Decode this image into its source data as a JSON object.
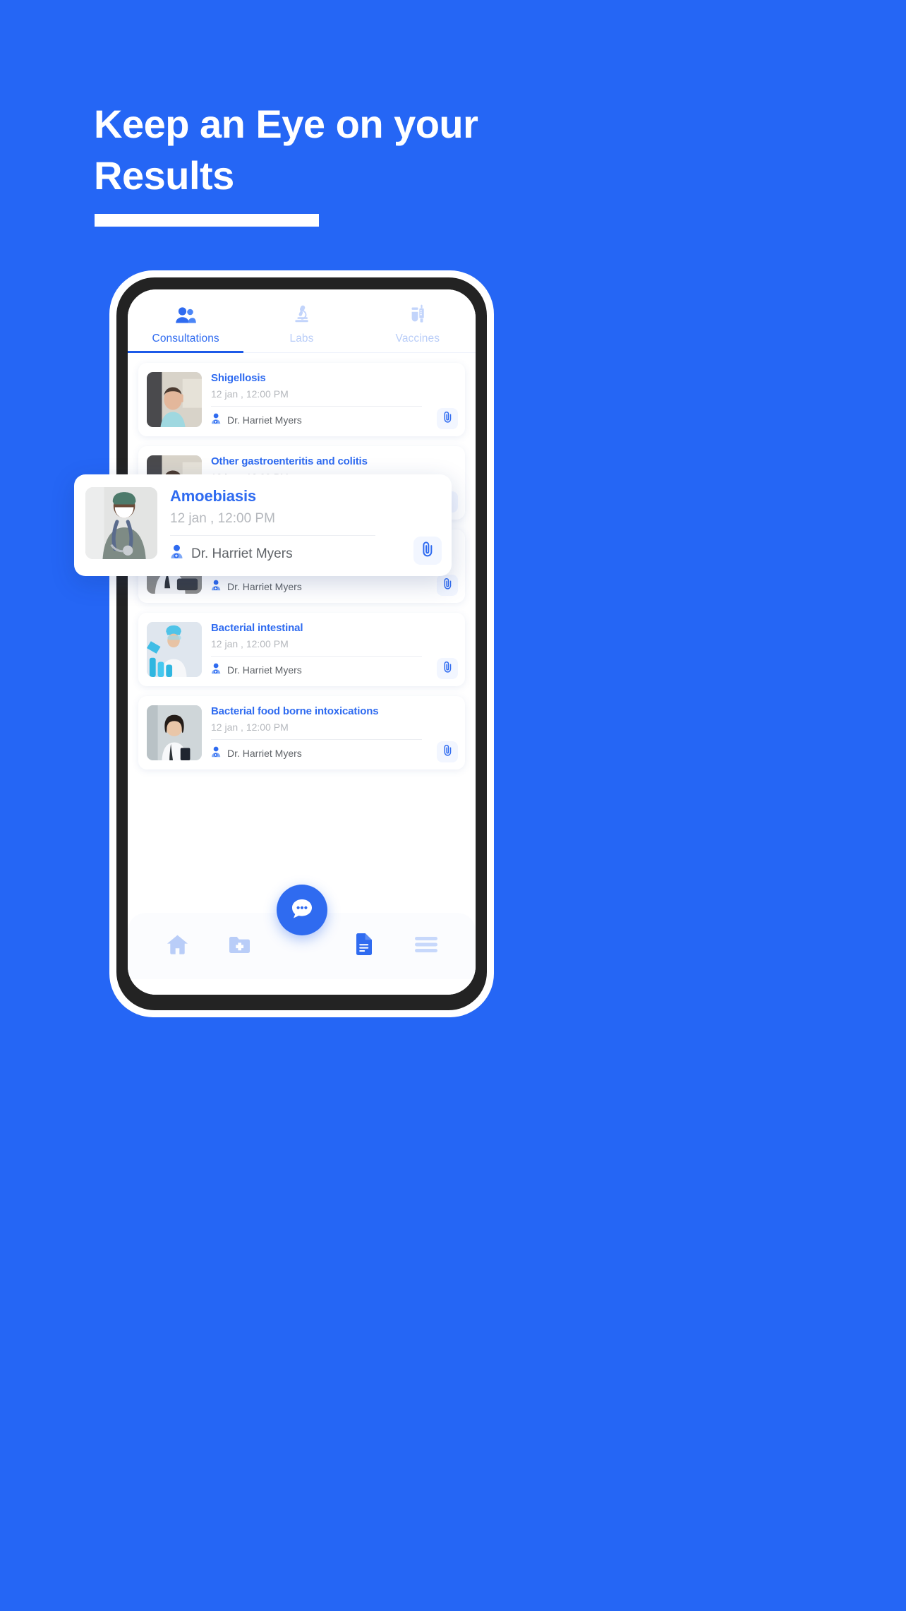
{
  "theme": {
    "background": "#2566f5",
    "accent": "#2f6bf0",
    "accent_dark": "#1d5ae8",
    "muted_blue": "#b9cdf8",
    "text_gray": "#5f6368",
    "date_gray": "#b5b8bd"
  },
  "hero": {
    "line1": "Keep an Eye on your",
    "line2": "Results"
  },
  "phone": {
    "tabs": [
      {
        "label": "Consultations",
        "icon": "people-icon",
        "active": true
      },
      {
        "label": "Labs",
        "icon": "microscope-icon",
        "active": false
      },
      {
        "label": "Vaccines",
        "icon": "syringe-icon",
        "active": false
      }
    ],
    "consultations": [
      {
        "title": "Shigellosis",
        "date": "12 jan , 12:00 PM",
        "doctor": "Dr. Harriet Myers",
        "thumb": "nurse-on-phone-photo",
        "attachment_icon": "paperclip-icon"
      },
      {
        "title": "Other gastroenteritis and colitis",
        "date": "12 jan , 12:00 PM",
        "doctor": "Dr. Harriet Myers",
        "thumb": "nurse-on-phone-photo",
        "attachment_icon": "paperclip-icon"
      },
      {
        "title": "Amoebiasis",
        "date": "12 jan , 12:00 PM",
        "doctor": "Dr. Harriet Myers",
        "thumb": "doctor-with-tablet-photo",
        "attachment_icon": "paperclip-icon"
      },
      {
        "title": "Bacterial intestinal",
        "date": "12 jan , 12:00 PM",
        "doctor": "Dr. Harriet Myers",
        "thumb": "lab-technician-photo",
        "attachment_icon": "paperclip-icon"
      },
      {
        "title": "Bacterial food borne intoxications",
        "date": "12 jan , 12:00 PM",
        "doctor": "Dr. Harriet Myers",
        "thumb": "female-doctor-photo",
        "attachment_icon": "paperclip-icon"
      }
    ],
    "highlighted_card": {
      "title": "Amoebiasis",
      "date": "12 jan , 12:00 PM",
      "doctor": "Dr. Harriet Myers",
      "thumb": "masked-doctor-photo",
      "attachment_icon": "paperclip-icon"
    },
    "bottom_nav": {
      "items": [
        {
          "icon": "home-icon",
          "active": false
        },
        {
          "icon": "folder-medical-icon",
          "active": false
        },
        {
          "icon": "document-icon",
          "active": true
        },
        {
          "icon": "hamburger-menu-icon",
          "active": false
        }
      ],
      "fab": {
        "icon": "chat-bubble-icon"
      }
    }
  }
}
